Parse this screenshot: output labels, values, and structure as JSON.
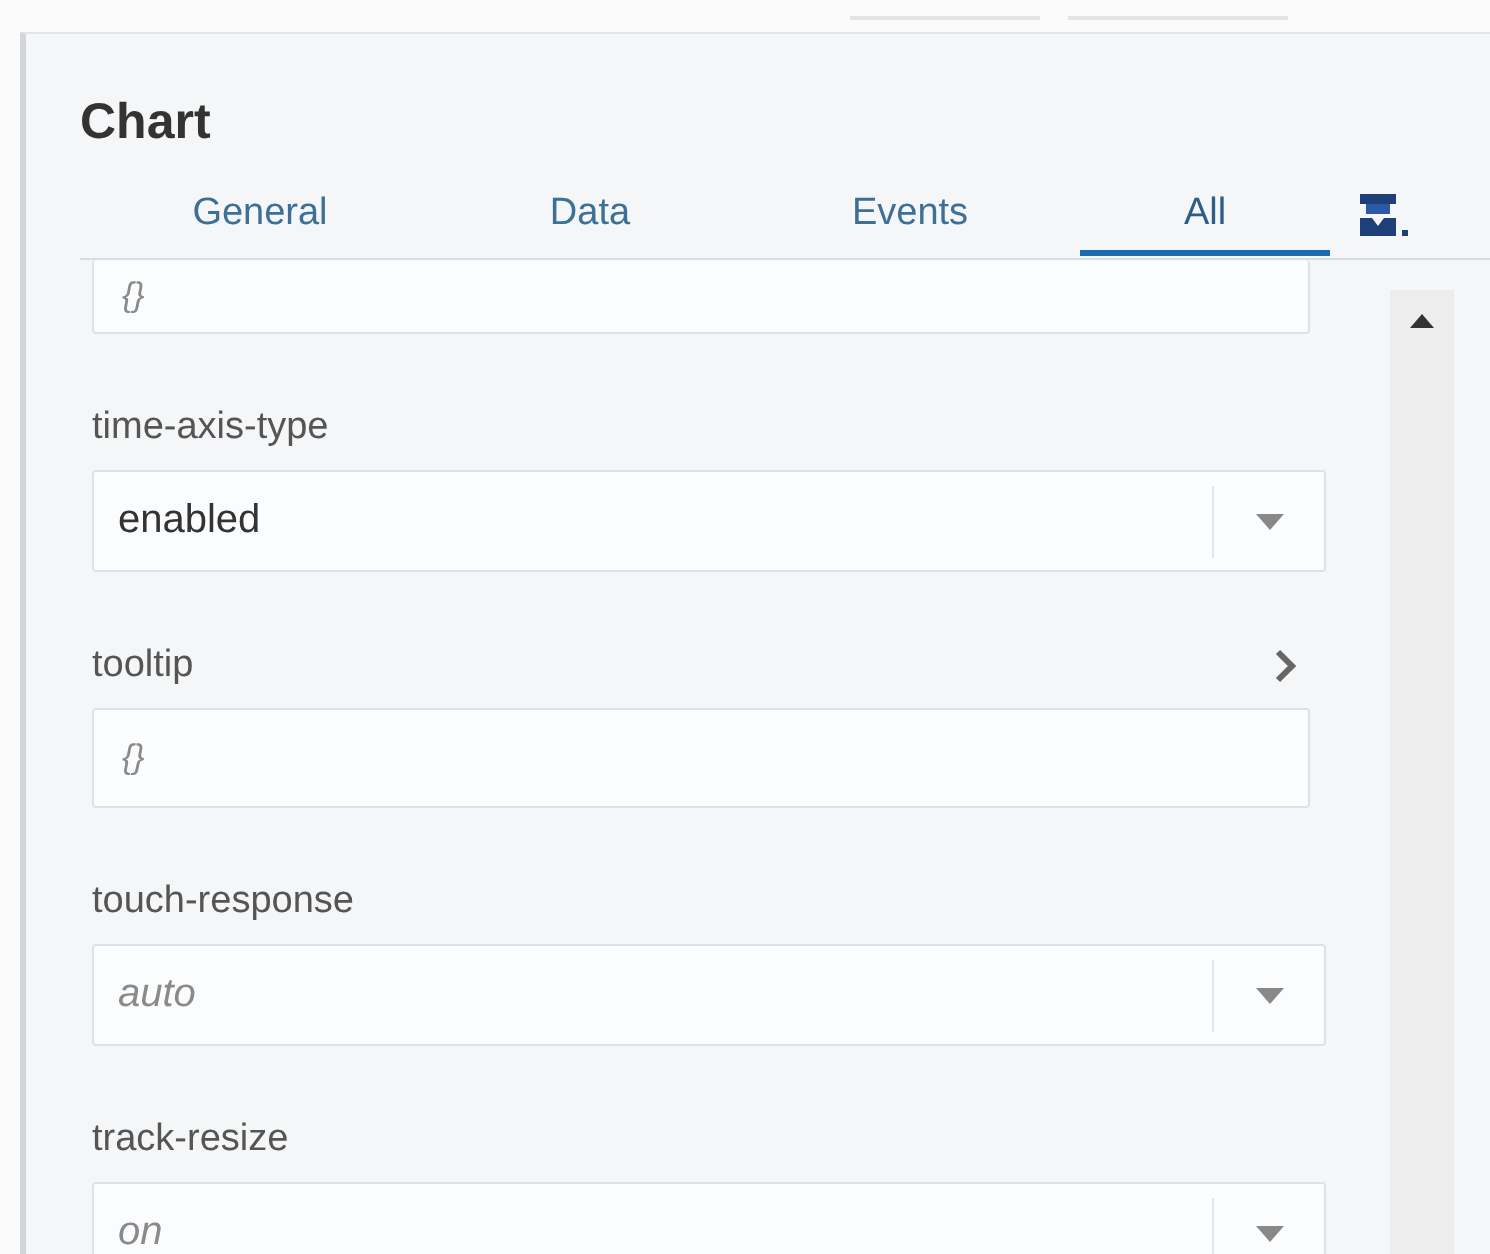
{
  "panel": {
    "title": "Chart"
  },
  "tabs": [
    {
      "label": "General",
      "selected": false
    },
    {
      "label": "Data",
      "selected": false
    },
    {
      "label": "Events",
      "selected": false
    },
    {
      "label": "All",
      "selected": true
    }
  ],
  "fields": [
    {
      "kind": "text",
      "placeholder": "{}",
      "partial": true
    },
    {
      "kind": "select",
      "label": "time-axis-type",
      "value": "enabled",
      "expandable": false
    },
    {
      "kind": "text",
      "label": "tooltip",
      "placeholder": "{}",
      "expandable": true
    },
    {
      "kind": "select",
      "label": "touch-response",
      "placeholder": "auto",
      "expandable": false
    },
    {
      "kind": "select",
      "label": "track-resize",
      "placeholder": "on",
      "expandable": false
    }
  ]
}
